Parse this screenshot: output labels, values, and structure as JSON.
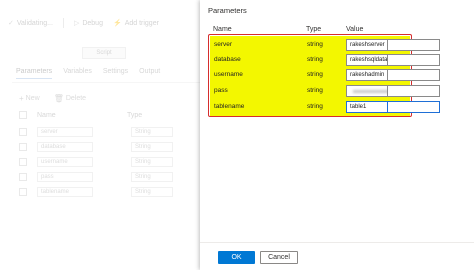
{
  "editor": {
    "toolbar": {
      "validating": "Validating...",
      "debug": "Debug",
      "add_trigger": "Add trigger"
    },
    "script_label": "Script",
    "tabs": [
      "Parameters",
      "Variables",
      "Settings",
      "Output"
    ],
    "actions": {
      "new": "New",
      "delete": "Delete"
    },
    "columns": {
      "name": "Name",
      "type": "Type"
    },
    "rows": [
      {
        "name": "server",
        "type": "String"
      },
      {
        "name": "database",
        "type": "String"
      },
      {
        "name": "username",
        "type": "String"
      },
      {
        "name": "pass",
        "type": "String"
      },
      {
        "name": "tablename",
        "type": "String"
      }
    ]
  },
  "panel": {
    "title": "Parameters",
    "columns": {
      "name": "Name",
      "type": "Type",
      "value": "Value"
    },
    "rows": [
      {
        "name": "server",
        "type": "string",
        "value": "rakeshserver"
      },
      {
        "name": "database",
        "type": "string",
        "value": "rakeshsqldatabase"
      },
      {
        "name": "username",
        "type": "string",
        "value": "rakeshadmin"
      },
      {
        "name": "pass",
        "type": "string",
        "value": ""
      },
      {
        "name": "tablename",
        "type": "string",
        "value": "table1"
      }
    ],
    "highlight_color": "#f3f700",
    "outline_color": "#d62d2d"
  },
  "footer": {
    "ok": "OK",
    "cancel": "Cancel"
  },
  "colors": {
    "primary": "#0078d4"
  }
}
